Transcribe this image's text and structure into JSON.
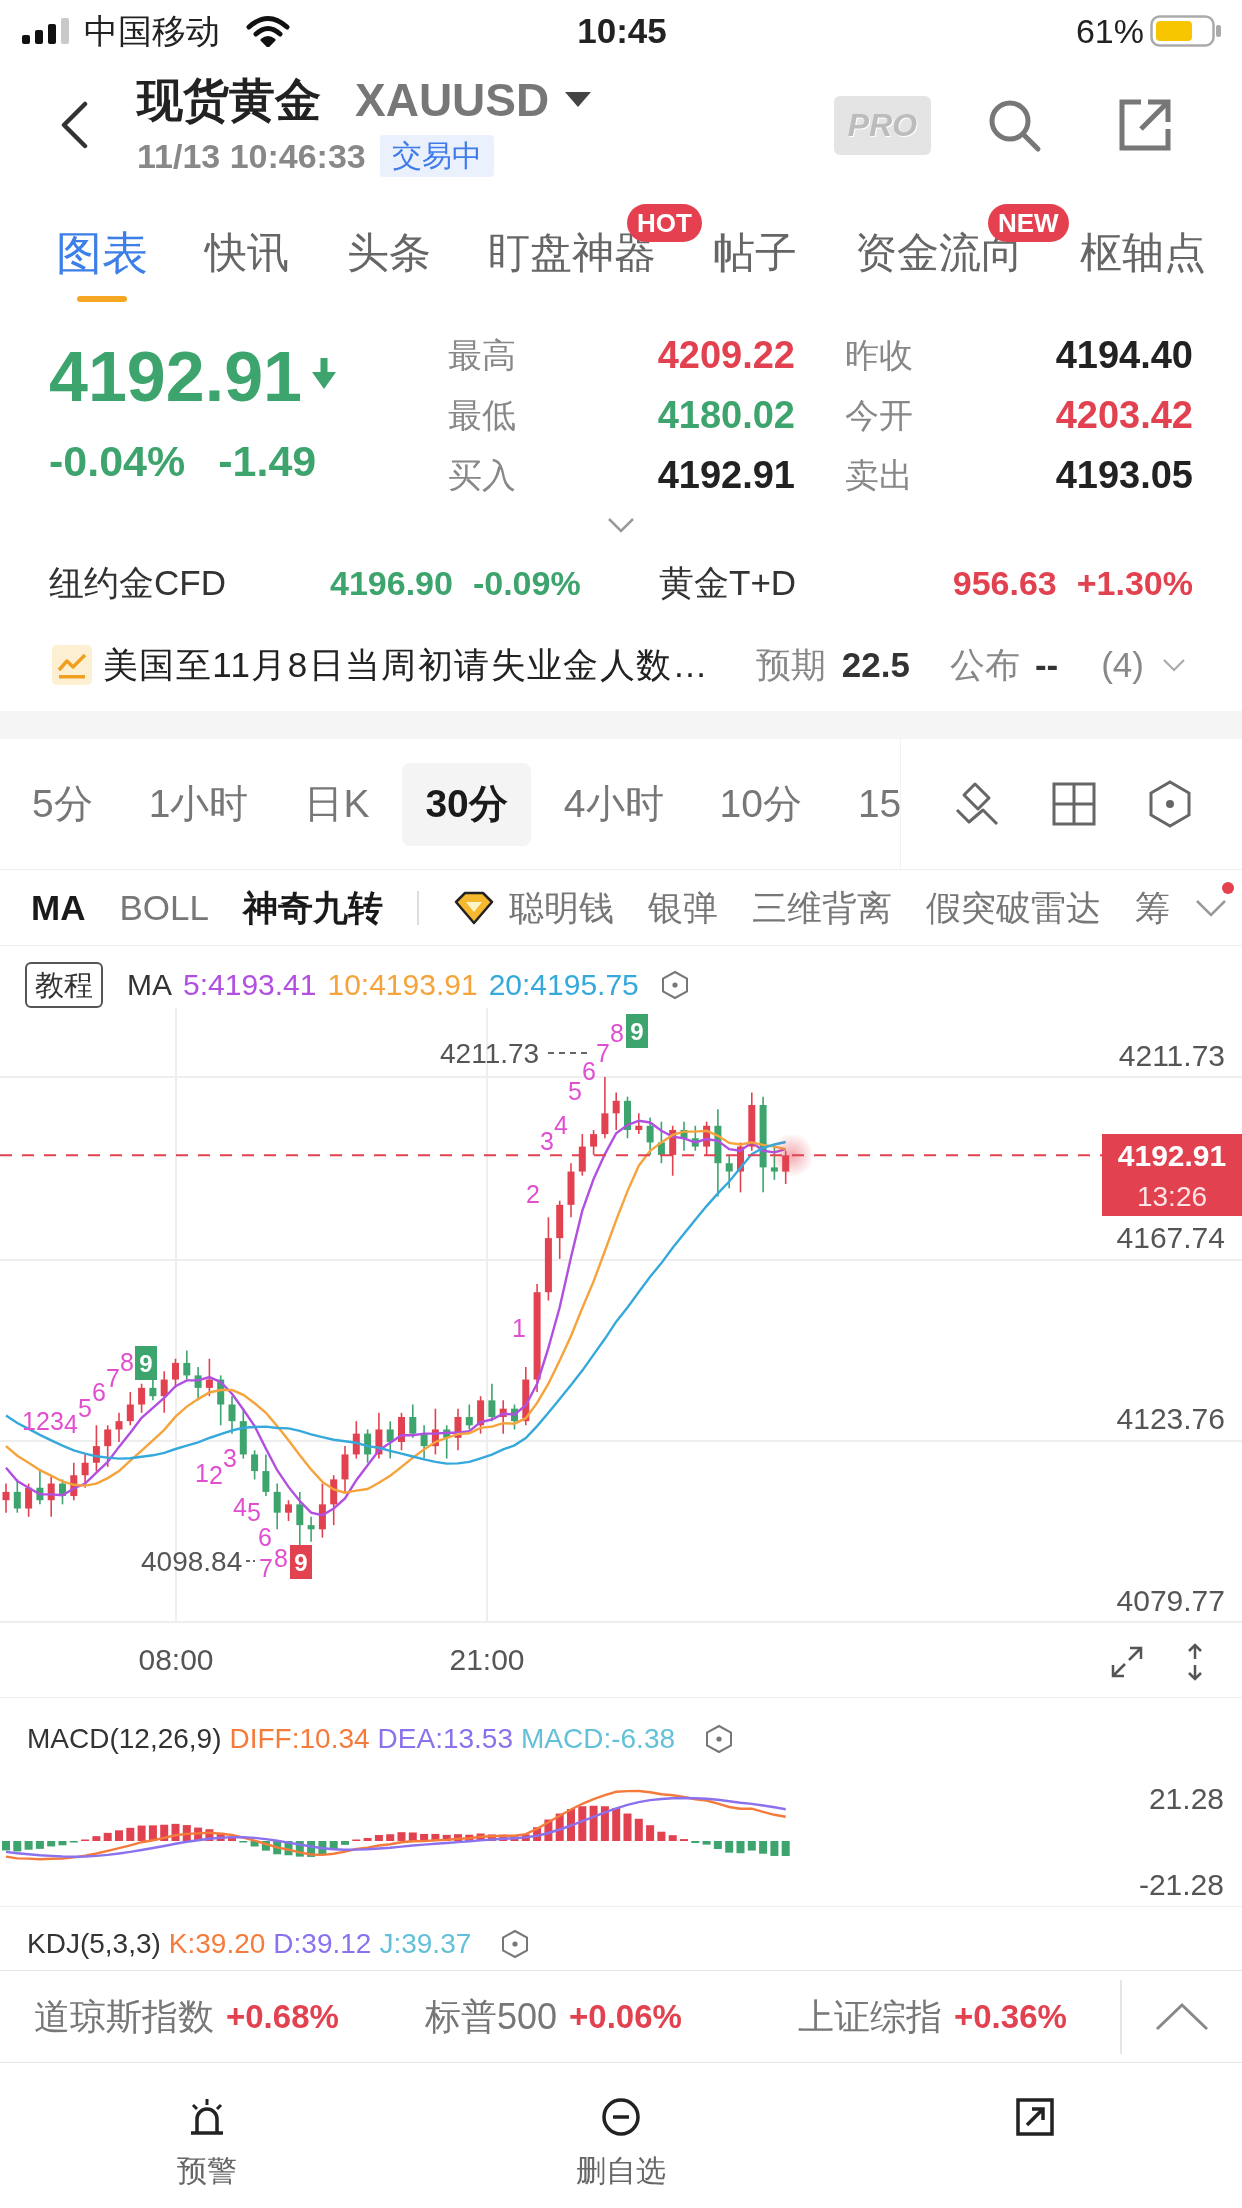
{
  "status_bar": {
    "carrier": "中国移动",
    "time": "10:45",
    "battery": "61%"
  },
  "header": {
    "title": "现货黄金",
    "symbol": "XAUUSD",
    "datetime": "11/13 10:46:33",
    "market_status": "交易中",
    "pro_badge": "PRO"
  },
  "tabs": [
    {
      "label": "图表",
      "selected": true
    },
    {
      "label": "快讯",
      "selected": false
    },
    {
      "label": "头条",
      "selected": false
    },
    {
      "label": "盯盘神器",
      "selected": false,
      "badge": "HOT"
    },
    {
      "label": "帖子",
      "selected": false
    },
    {
      "label": "资金流向",
      "selected": false,
      "badge": "NEW"
    },
    {
      "label": "枢轴点",
      "selected": false
    }
  ],
  "quote": {
    "price": "4192.91",
    "falling": true,
    "change_percent": "-0.04%",
    "change": "-1.49",
    "stats": [
      {
        "label": "最高",
        "value": "4209.22",
        "color": "#e2414f"
      },
      {
        "label": "昨收",
        "value": "4194.40",
        "color": "#222222"
      },
      {
        "label": "最低",
        "value": "4180.02",
        "color": "#3da46e"
      },
      {
        "label": "今开",
        "value": "4203.42",
        "color": "#e2414f"
      },
      {
        "label": "买入",
        "value": "4192.91",
        "color": "#222222"
      },
      {
        "label": "卖出",
        "value": "4193.05",
        "color": "#222222"
      }
    ]
  },
  "related": [
    {
      "name": "纽约金CFD",
      "price": "4196.90",
      "change": "-0.09%",
      "color": "#3da46e"
    },
    {
      "name": "黄金T+D",
      "price": "956.63",
      "change": "+1.30%",
      "color": "#e2414f"
    }
  ],
  "event": {
    "title": "美国至11月8日当周初请失业金人数…",
    "forecast_label": "预期",
    "forecast": "22.5",
    "actual_label": "公布",
    "actual": "--",
    "count": "(4)"
  },
  "timeframes": [
    {
      "label": "5分",
      "selected": false
    },
    {
      "label": "1小时",
      "selected": false
    },
    {
      "label": "日K",
      "selected": false
    },
    {
      "label": "30分",
      "selected": true
    },
    {
      "label": "4小时",
      "selected": false
    },
    {
      "label": "10分",
      "selected": false
    },
    {
      "label": "15",
      "selected": false
    }
  ],
  "indicators": [
    {
      "label": "MA",
      "kind": "plain",
      "selected": true
    },
    {
      "label": "BOLL",
      "kind": "plain",
      "selected": false
    },
    {
      "label": "神奇九转",
      "kind": "plain",
      "selected": true
    },
    {
      "label": "聪明钱",
      "kind": "premium",
      "selected": false
    },
    {
      "label": "银弹",
      "kind": "plain",
      "selected": false
    },
    {
      "label": "三维背离",
      "kind": "plain",
      "selected": false
    },
    {
      "label": "假突破雷达",
      "kind": "plain",
      "selected": false
    },
    {
      "label": "筹",
      "kind": "plain",
      "selected": false
    }
  ],
  "indicator_menu": {
    "has_new": true
  },
  "chart": {
    "tutorial": "教程",
    "ma_label": "MA",
    "ma_values": [
      {
        "text": "5:4193.41",
        "color": "#b14fe0"
      },
      {
        "text": "10:4193.91",
        "color": "#f5a33a"
      },
      {
        "text": "20:4195.75",
        "color": "#36a9dc"
      }
    ],
    "price_axis": [
      "4211.73",
      "4167.74",
      "4123.76",
      "4079.77"
    ],
    "time_axis": [
      "08:00",
      "21:00"
    ],
    "high_label": "4211.73",
    "low_label": "4098.84",
    "last_price": "4192.91",
    "countdown": "13:26",
    "sequences": [
      {
        "counts": [
          "1",
          "2",
          "3",
          "4",
          "5",
          "6",
          "7",
          "8"
        ],
        "final": "9",
        "color": "#3da46e"
      },
      {
        "counts": [
          "1",
          "2",
          "3",
          "4",
          "5",
          "6",
          "7",
          "8"
        ],
        "final": "9",
        "color": "#e2414f"
      },
      {
        "counts": [
          "1",
          "2",
          "3",
          "4",
          "5",
          "6",
          "7",
          "8"
        ],
        "final": "9",
        "color": "#3da46e"
      }
    ]
  },
  "macd": {
    "title": "MACD(12,26,9)",
    "values": [
      {
        "text": "DIFF:10.34",
        "color": "#f47b3b"
      },
      {
        "text": "DEA:13.53",
        "color": "#8b71ee"
      },
      {
        "text": "MACD:-6.38",
        "color": "#64c0d8"
      }
    ],
    "axis": [
      "21.28",
      "-21.28"
    ]
  },
  "kdj": {
    "title": "KDJ(5,3,3)",
    "values": [
      {
        "text": "K:39.20",
        "color": "#f47b3b"
      },
      {
        "text": "D:39.12",
        "color": "#8b71ee"
      },
      {
        "text": "J:39.37",
        "color": "#64c0d8"
      }
    ]
  },
  "ticker": [
    {
      "name": "道琼斯指数",
      "change": "+0.68%",
      "rising": true
    },
    {
      "name": "标普500",
      "change": "+0.06%",
      "rising": true
    },
    {
      "name": "上证综指",
      "change": "+0.36%",
      "rising": true
    }
  ],
  "bottom_bar": [
    {
      "kind": "alarm",
      "label": "预警"
    },
    {
      "kind": "minus",
      "label": "删自选"
    },
    {
      "kind": "arrow-box"
    }
  ]
}
